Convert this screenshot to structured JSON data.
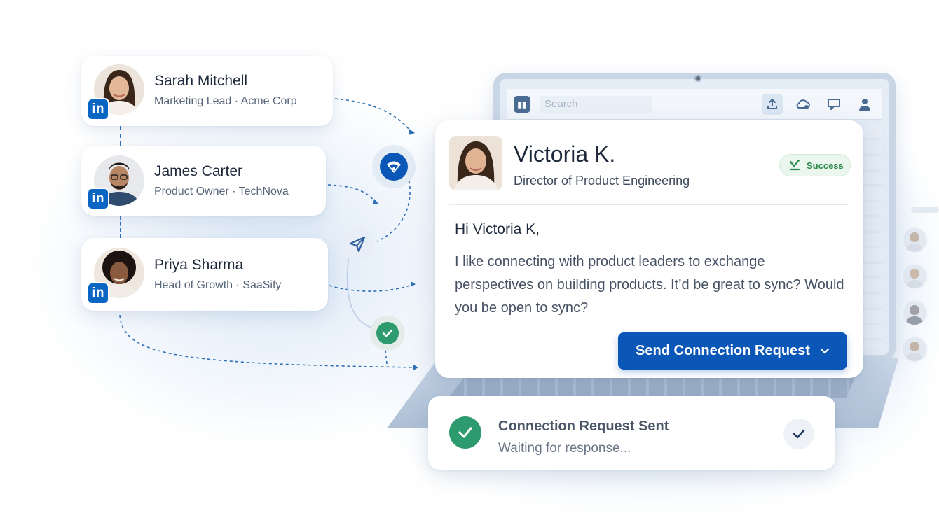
{
  "contacts": [
    {
      "name": "Sarah Mitchell",
      "role": "Marketing Lead · Acme Corp",
      "badge": "in"
    },
    {
      "name": "James Carter",
      "role": "Product Owner · TechNova",
      "badge": "in"
    },
    {
      "name": "Priya Sharma",
      "role": "Head of Growth · SaaSify",
      "badge": "in"
    }
  ],
  "laptop": {
    "search_placeholder": "Search",
    "icons": [
      "upload-icon",
      "cloud-icon",
      "chat-icon",
      "user-icon"
    ]
  },
  "message": {
    "name": "Victoria K.",
    "title": "Director of Product Engineering",
    "status_badge": "Success",
    "greeting": "Hi Victoria K,",
    "body": "I like connecting with product leaders to exchange perspectives on building products. It’d be great to sync? Would you be open to sync?",
    "send_button": "Send Connection Request"
  },
  "status": {
    "title": "Connection Request Sent",
    "subtitle": "Waiting for response..."
  },
  "colors": {
    "linkedin_blue": "#0a66c2",
    "primary_button": "#0b57b8",
    "success_green": "#2e9b6e",
    "connector": "#2f6fb7"
  }
}
